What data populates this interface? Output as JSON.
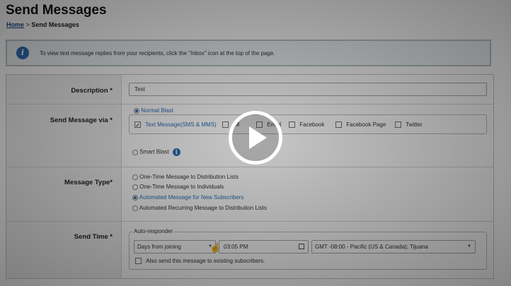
{
  "page": {
    "title": "Send Messages",
    "breadcrumb": {
      "home": "Home",
      "separator": ">",
      "current": "Send Messages"
    }
  },
  "info": {
    "icon": "info-icon",
    "icon_glyph": "i",
    "text": "To view text message replies from your recipients, click the \"Inbox\" icon at the top of the page."
  },
  "form": {
    "description": {
      "label": "Description",
      "required": "*",
      "value": "Test"
    },
    "send_via": {
      "label": "Send Message via",
      "required": "*",
      "normal_blast": "Normal Blast",
      "normal_blast_selected": true,
      "channels": [
        {
          "label": "Text Message(SMS & MMS)",
          "checked": true
        },
        {
          "label": "IM",
          "checked": false
        },
        {
          "label": "Email",
          "checked": false
        },
        {
          "label": "Facebook",
          "checked": false
        },
        {
          "label": "Facebook Page",
          "checked": false
        },
        {
          "label": "Twitter",
          "checked": false
        }
      ],
      "smart_blast": "Smart Blast",
      "smart_blast_selected": false
    },
    "message_type": {
      "label": "Message Type",
      "required": "*",
      "options": [
        {
          "label": "One-Time Message to Distribution Lists",
          "selected": false
        },
        {
          "label": "One-Time Message to Individuals",
          "selected": false
        },
        {
          "label": "Automated Message for New Subscribers",
          "selected": true
        },
        {
          "label": "Automated Recurring Message to Distribution Lists",
          "selected": false
        }
      ]
    },
    "send_time": {
      "label": "Send Time",
      "required": "*",
      "group_label": "Auto-responder",
      "schedule_value": "Days from joining",
      "time_value": "03:05 PM",
      "timezone_value": "GMT -08:00 - Pacific (US & Canada); Tijuana",
      "existing_label": "Also send this message to existing subscribers."
    }
  },
  "video": {
    "play_icon": "play-icon"
  },
  "colors": {
    "accent": "#2a6fb8",
    "required": "#c41d1d",
    "label_bg": "#f0f0f0"
  }
}
